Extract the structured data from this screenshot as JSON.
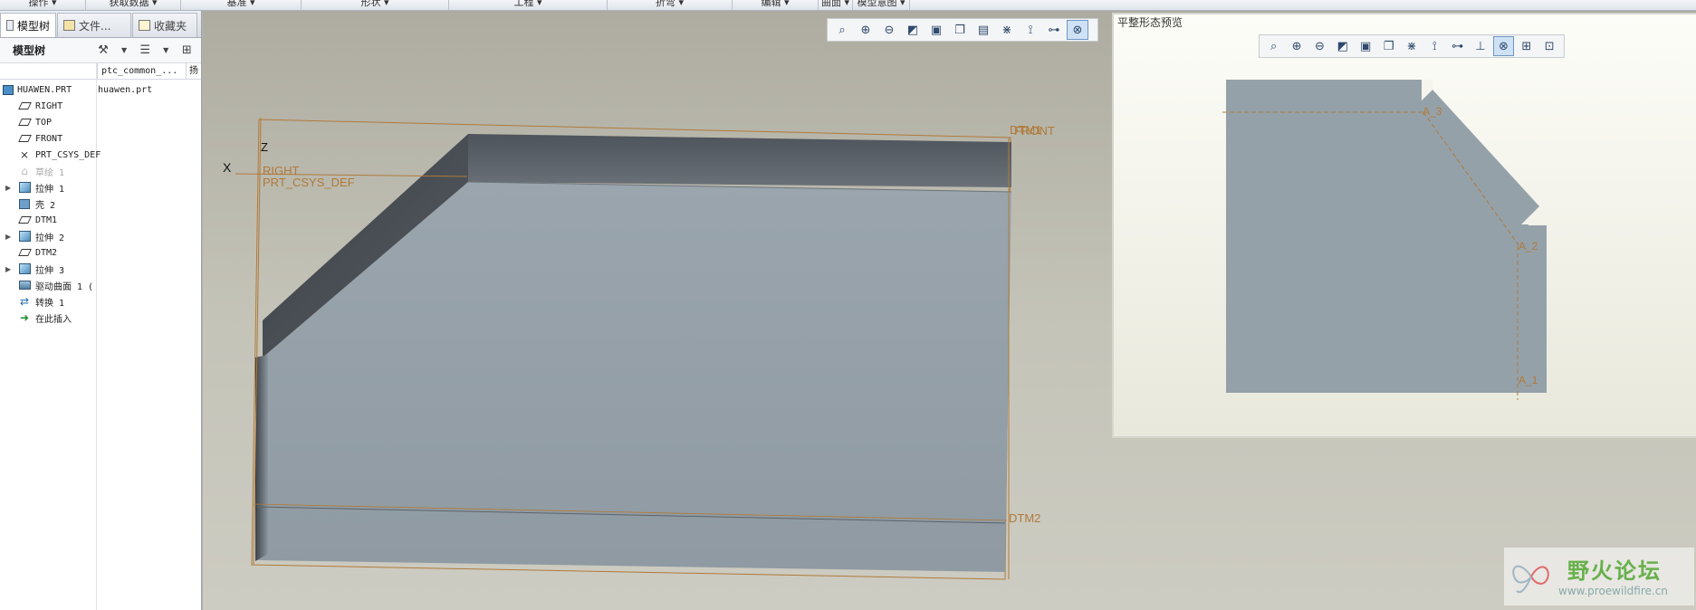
{
  "ribbon": {
    "groups": [
      "操作 ▾",
      "获取数据 ▾",
      "基准 ▾",
      "形状 ▾",
      "工程 ▾",
      "折弯 ▾",
      "编辑 ▾",
      "曲面 ▾",
      "模型意图 ▾"
    ]
  },
  "left_panel": {
    "tabs": [
      "模型树",
      "文件...",
      "收藏夹"
    ],
    "tree_title": "模型树",
    "column_header": "ptc_common_...",
    "column_header_extra": "扬",
    "file_cell": "huawen.prt",
    "tree": [
      {
        "label": "HUAWEN.PRT",
        "icon": "part-icon"
      },
      {
        "label": "RIGHT",
        "icon": "datum-plane-icon"
      },
      {
        "label": "TOP",
        "icon": "datum-plane-icon"
      },
      {
        "label": "FRONT",
        "icon": "datum-plane-icon"
      },
      {
        "label": "PRT_CSYS_DEF",
        "icon": "csys-icon"
      },
      {
        "label": "草绘 1",
        "icon": "sketch-icon"
      },
      {
        "label": "拉伸 1",
        "icon": "extrude-icon",
        "expandable": true
      },
      {
        "label": "壳 2",
        "icon": "shell-icon"
      },
      {
        "label": "DTM1",
        "icon": "datum-plane-icon"
      },
      {
        "label": "拉伸 2",
        "icon": "extrude-icon",
        "expandable": true
      },
      {
        "label": "DTM2",
        "icon": "datum-plane-icon"
      },
      {
        "label": "拉伸 3",
        "icon": "extrude-icon",
        "expandable": true
      },
      {
        "label": "驱动曲面 1 (",
        "icon": "driving-surface-icon"
      },
      {
        "label": "转换 1",
        "icon": "conversion-icon"
      },
      {
        "label": "在此插入",
        "icon": "insert-arrow-icon"
      }
    ]
  },
  "viewport": {
    "labels": {
      "x_axis": "X",
      "z_axis": "Z",
      "right": "RIGHT",
      "csys": "PRT_CSYS_DEF",
      "dtm1": "DTM1",
      "front": "FRONT",
      "dtm2": "DTM2"
    }
  },
  "preview": {
    "title": "平整形态预览",
    "labels": {
      "a3": "A_3",
      "a2": "A_2",
      "a1": "A_1"
    }
  },
  "watermark": {
    "title": "野火论坛",
    "url": "www.proewildfire.cn"
  },
  "colors": {
    "part": "#95a1a9",
    "dark_face": "#41464c",
    "datum": "#b07a3a",
    "accent": "#6f96c6"
  }
}
